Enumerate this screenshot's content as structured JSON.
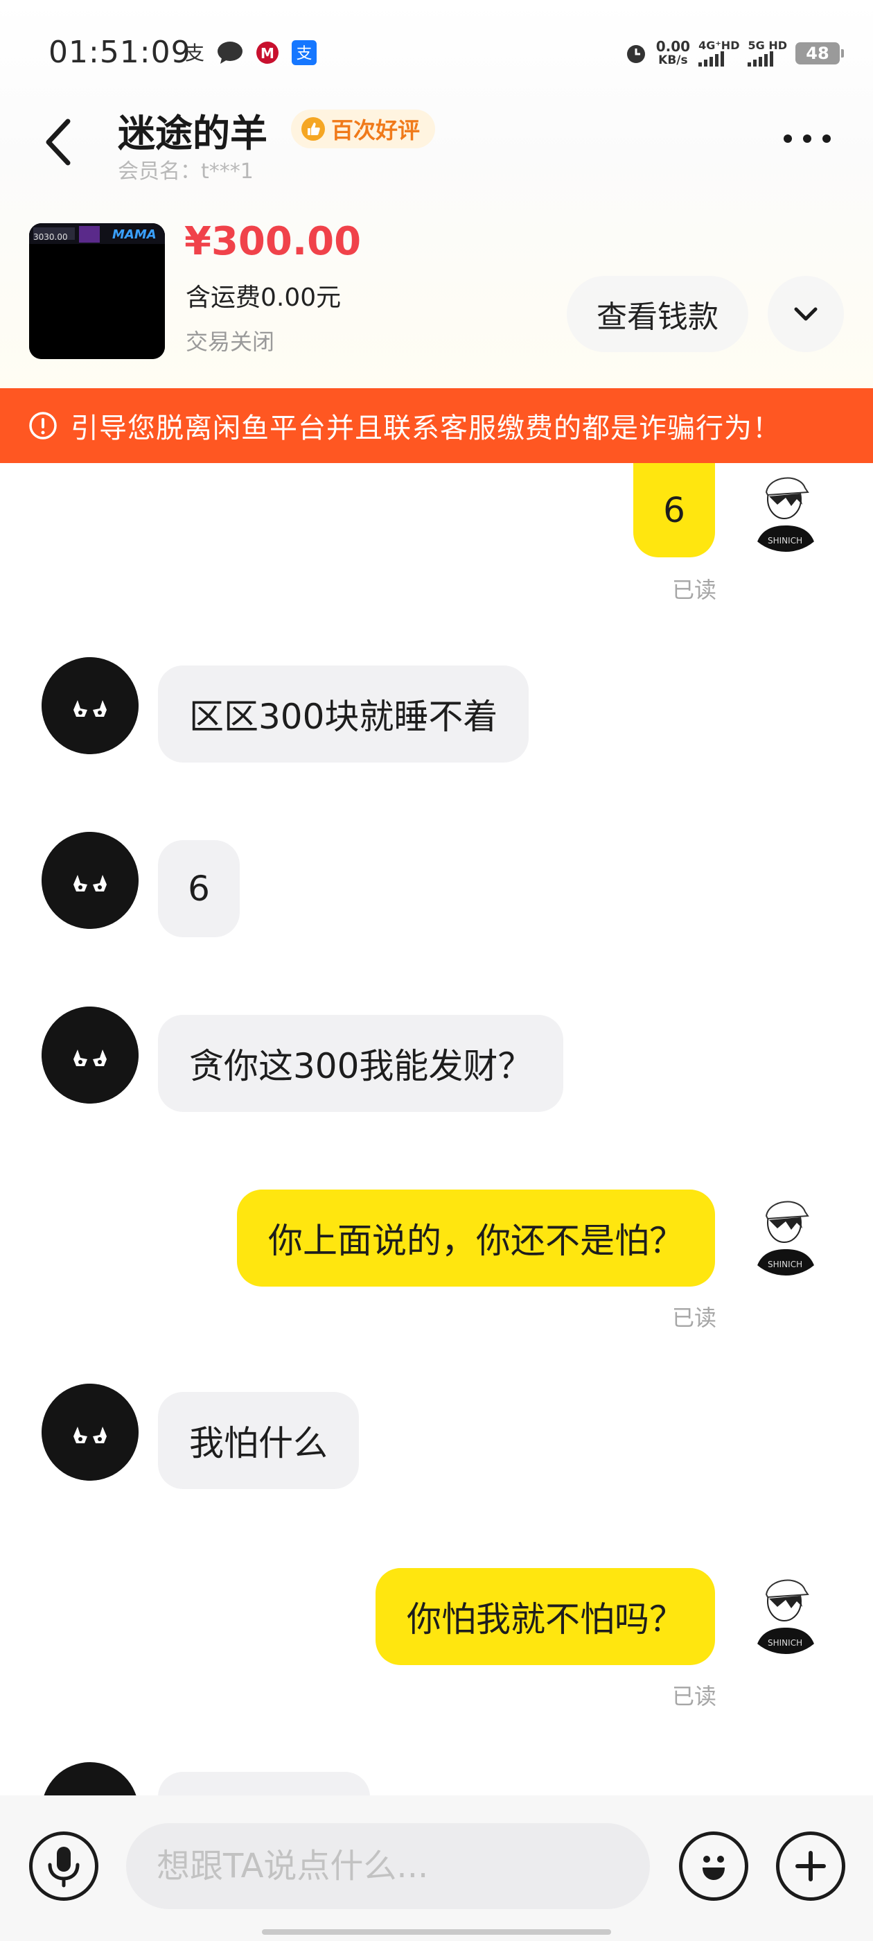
{
  "status_bar": {
    "time": "01:51:09",
    "net_speed_value": "0.00",
    "net_speed_unit": "KB/s",
    "network_1": "4G⁺HD",
    "network_2": "5G HD",
    "battery": "48"
  },
  "header": {
    "seller_name": "迷途的羊",
    "badge": "百次好评",
    "member_label": "会员名：t***1"
  },
  "product": {
    "price": "¥300.00",
    "shipping": "含运费0.00元",
    "status": "交易关闭",
    "view_payment_button": "查看钱款",
    "thumb_text_1": "3030.00",
    "thumb_text_2": "MAMA"
  },
  "warning": {
    "text": "引导您脱离闲鱼平台并且联系客服缴费的都是诈骗行为！"
  },
  "messages": [
    {
      "from": "me",
      "text": "6",
      "read": "已读"
    },
    {
      "from": "other",
      "text": "区区300块就睡不着"
    },
    {
      "from": "other",
      "text": "6"
    },
    {
      "from": "other",
      "text": "贪你这300我能发财？"
    },
    {
      "from": "me",
      "text": "你上面说的，你还不是怕？",
      "read": "已读"
    },
    {
      "from": "other",
      "text": "我怕什么"
    },
    {
      "from": "me",
      "text": "你怕我就不怕吗？",
      "read": "已读"
    }
  ],
  "input": {
    "placeholder": "想跟TA说点什么..."
  },
  "colors": {
    "accent_yellow": "#ffe60f",
    "warning_orange": "#ff5722",
    "price_red": "#f0424a",
    "badge_orange": "#f07a1a"
  }
}
